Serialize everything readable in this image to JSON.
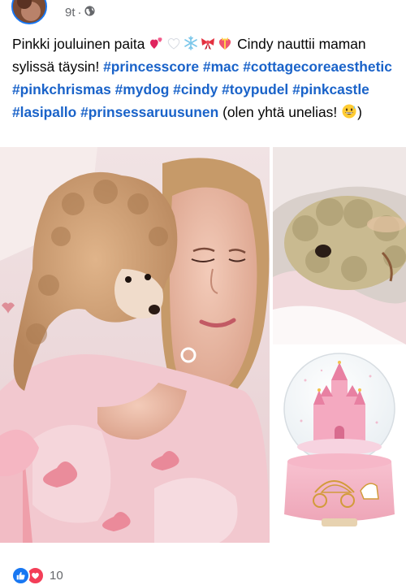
{
  "post": {
    "time": "9t",
    "separator": "·",
    "audience_icon": "globe-icon",
    "text_start": "Pinkki jouluinen paita",
    "text_after_emoji": "Cindy nauttii maman sylissä täysin!",
    "hashtags": [
      "#princesscore",
      "#mac",
      "#cottagecoreaesthetic",
      "#pinkchrismas",
      "#mydog",
      "#cindy",
      "#toypudel",
      "#pinkcastle",
      "#lasipallo",
      "#prinsessaruusunen"
    ],
    "text_end": "(olen yhtä unelias!",
    "text_end_close": ")",
    "emoji_sequence": [
      "two-hearts-emoji",
      "white-heart-emoji",
      "snowflake-emoji",
      "ribbon-emoji",
      "heart-ribbon-emoji"
    ],
    "end_emoji": "grinning-sweat-emoji"
  },
  "photos": [
    {
      "subject": "woman-with-poodle-photo"
    },
    {
      "subject": "sleeping-poodle-photo"
    },
    {
      "subject": "snow-globe-castle-photo"
    }
  ],
  "reactions": {
    "icons": [
      "like-icon",
      "love-icon"
    ],
    "count": "10"
  },
  "colors": {
    "hashtag": "#1a63c9",
    "meta": "#65676b",
    "like": "#1877f2",
    "love": "#f33e58"
  }
}
